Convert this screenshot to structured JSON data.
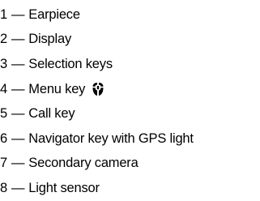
{
  "legend": {
    "separator": "—",
    "items": [
      {
        "number": "1",
        "label": "Earpiece"
      },
      {
        "number": "2",
        "label": "Display"
      },
      {
        "number": "3",
        "label": "Selection keys"
      },
      {
        "number": "4",
        "label": "Menu key",
        "icon": "menu-key-icon"
      },
      {
        "number": "5",
        "label": "Call key"
      },
      {
        "number": "6",
        "label": "Navigator key with GPS light"
      },
      {
        "number": "7",
        "label": "Secondary camera"
      },
      {
        "number": "8",
        "label": "Light sensor"
      }
    ]
  }
}
